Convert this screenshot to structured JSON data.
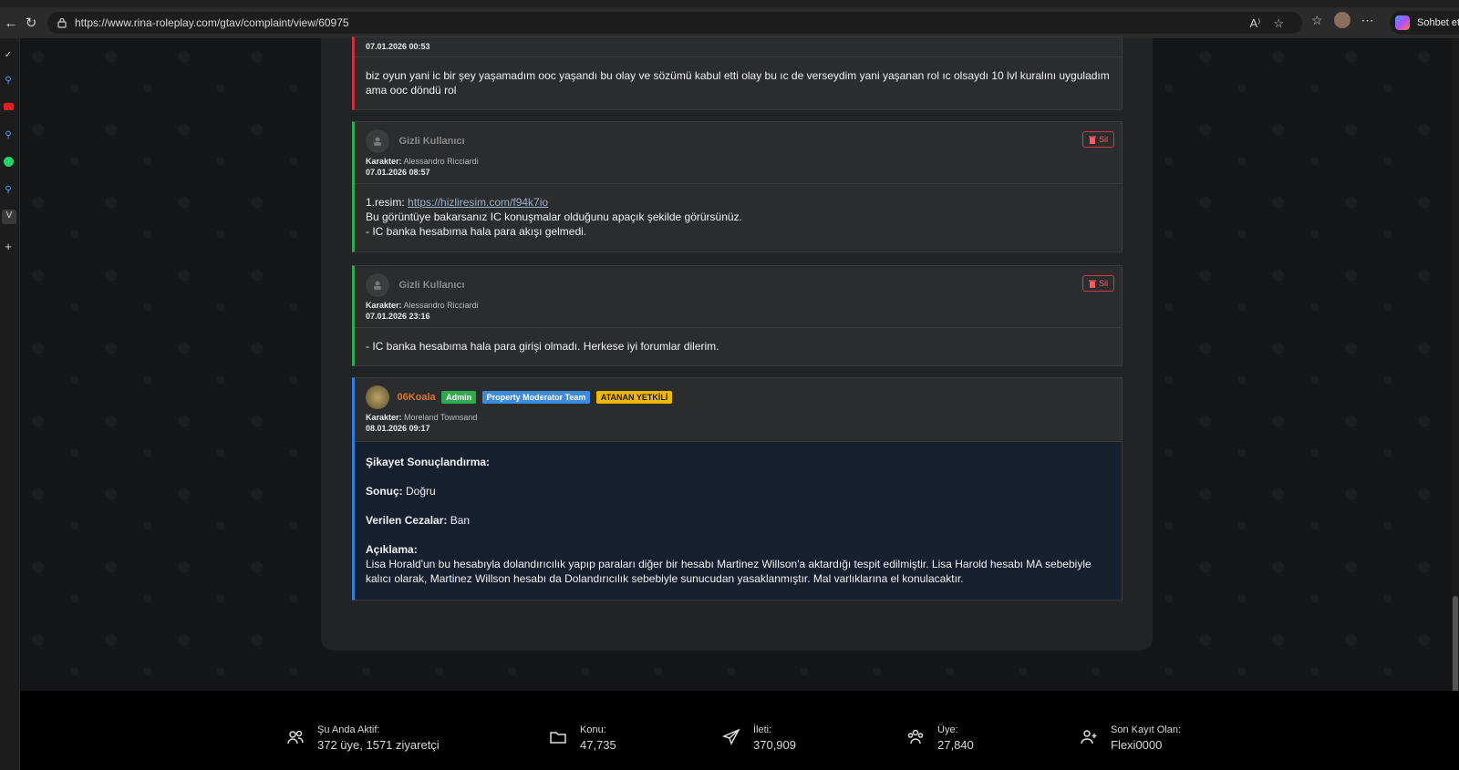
{
  "browser": {
    "url": "https://www.rina-roleplay.com/gtav/complaint/view/60975",
    "copilot_label": "Sohbet et"
  },
  "posts": [
    {
      "date": "07.01.2026 00:53",
      "body": "biz oyun yani ic bir şey yaşamadım ooc yaşandı bu olay ve sözümü kabul etti olay bu ıc de verseydim yani yaşanan rol ıc olsaydı 10 lvl kuralını uyguladım ama ooc döndü rol"
    },
    {
      "user": "Gizli Kullanıcı",
      "karakter_label": "Karakter:",
      "karakter": "Alessandro Ricciardi",
      "date": "07.01.2026 08:57",
      "delete_label": "Sil",
      "line1_prefix": "1.resim: ",
      "line1_link": "https://hizliresim.com/f94k7io",
      "line2": "Bu görüntüye bakarsanız IC konuşmalar olduğunu apaçık şekilde görürsünüz.",
      "line3": "- IC banka hesabıma hala para akışı gelmedi."
    },
    {
      "user": "Gizli Kullanıcı",
      "karakter_label": "Karakter:",
      "karakter": "Alessandro Ricciardi",
      "date": "07.01.2026 23:16",
      "delete_label": "Sil",
      "body": "- IC banka hesabıma hala para girişi olmadı. Herkese iyi forumlar dilerim."
    },
    {
      "user": "06Koala",
      "badges": [
        "Admin",
        "Property Moderator Team",
        "ATANAN YETKİLİ"
      ],
      "karakter_label": "Karakter:",
      "karakter": "Moreland Townsand",
      "date": "08.01.2026 09:17",
      "heading": "Şikayet Sonuçlandırma:",
      "result_label": "Sonuç:",
      "result_value": "Doğru",
      "penalty_label": "Verilen Cezalar:",
      "penalty_value": "Ban",
      "desc_label": "Açıklama:",
      "desc": "Lisa Horald'un bu hesabıyla dolandırıcılık yapıp paraları diğer bir hesabı Martinez Willson'a aktardığı tespit edilmiştir. Lisa Harold hesabı MA sebebiyle kalıcı olarak, Martinez Willson hesabı da Dolandırıcılık sebebiyle sunucudan yasaklanmıştır. Mal varlıklarına el konulacaktır."
    }
  ],
  "footer": {
    "stats": [
      {
        "icon": "users-icon",
        "label": "Şu Anda Aktif:",
        "value": "372 üye, 1571 ziyaretçi"
      },
      {
        "icon": "folder-icon",
        "label": "Konu:",
        "value": "47,735"
      },
      {
        "icon": "send-icon",
        "label": "İleti:",
        "value": "370,909"
      },
      {
        "icon": "members-icon",
        "label": "Üye:",
        "value": "27,840"
      },
      {
        "icon": "user-plus-icon",
        "label": "Son Kayıt Olan:",
        "value": "Flexi0000"
      }
    ]
  }
}
